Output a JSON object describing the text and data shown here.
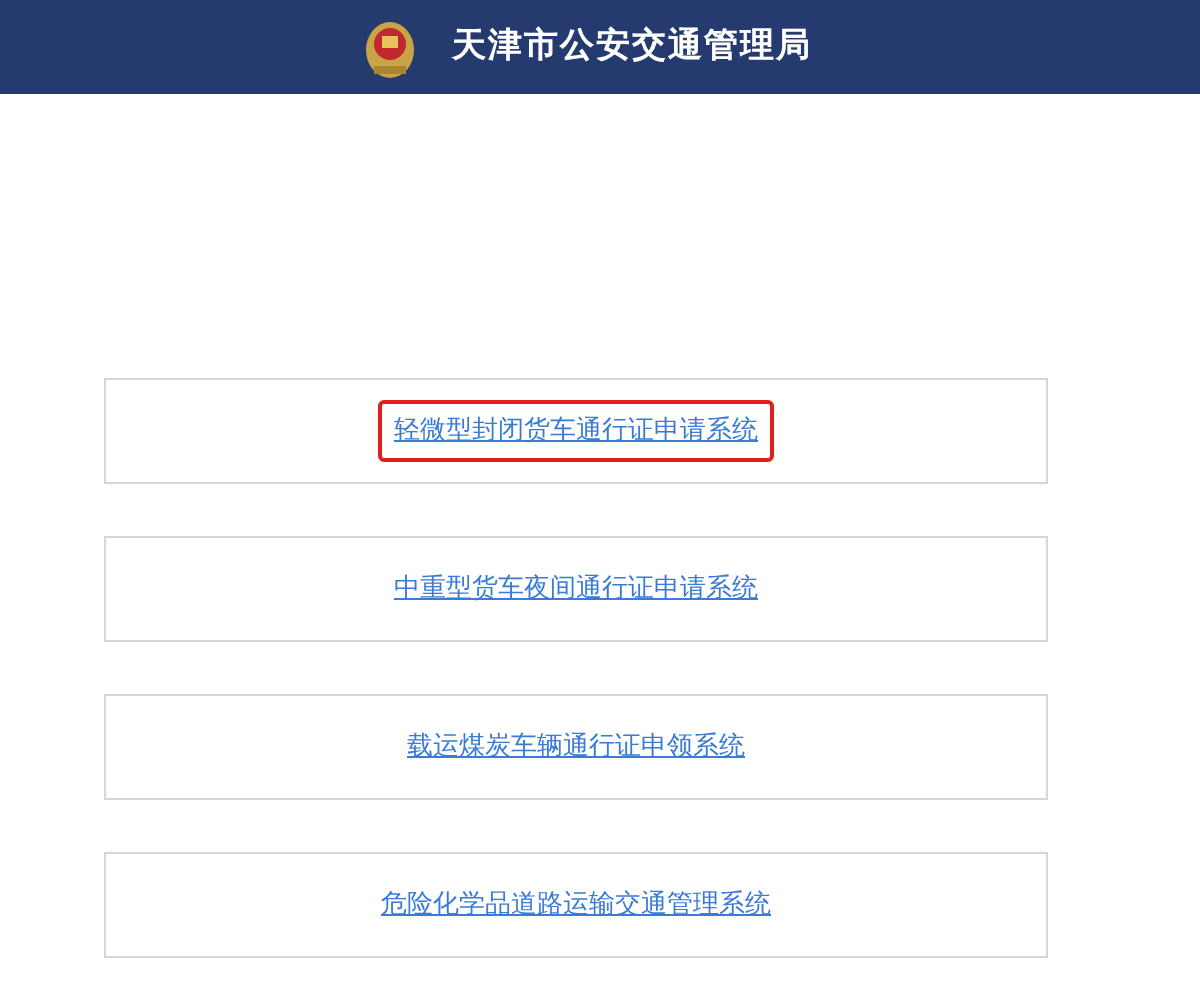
{
  "header": {
    "title": "天津市公安交通管理局"
  },
  "systems": [
    {
      "label": "轻微型封闭货车通行证申请系统",
      "highlighted": true
    },
    {
      "label": "中重型货车夜间通行证申请系统",
      "highlighted": false
    },
    {
      "label": "载运煤炭车辆通行证申领系统",
      "highlighted": false
    },
    {
      "label": "危险化学品道路运输交通管理系统",
      "highlighted": false
    }
  ]
}
